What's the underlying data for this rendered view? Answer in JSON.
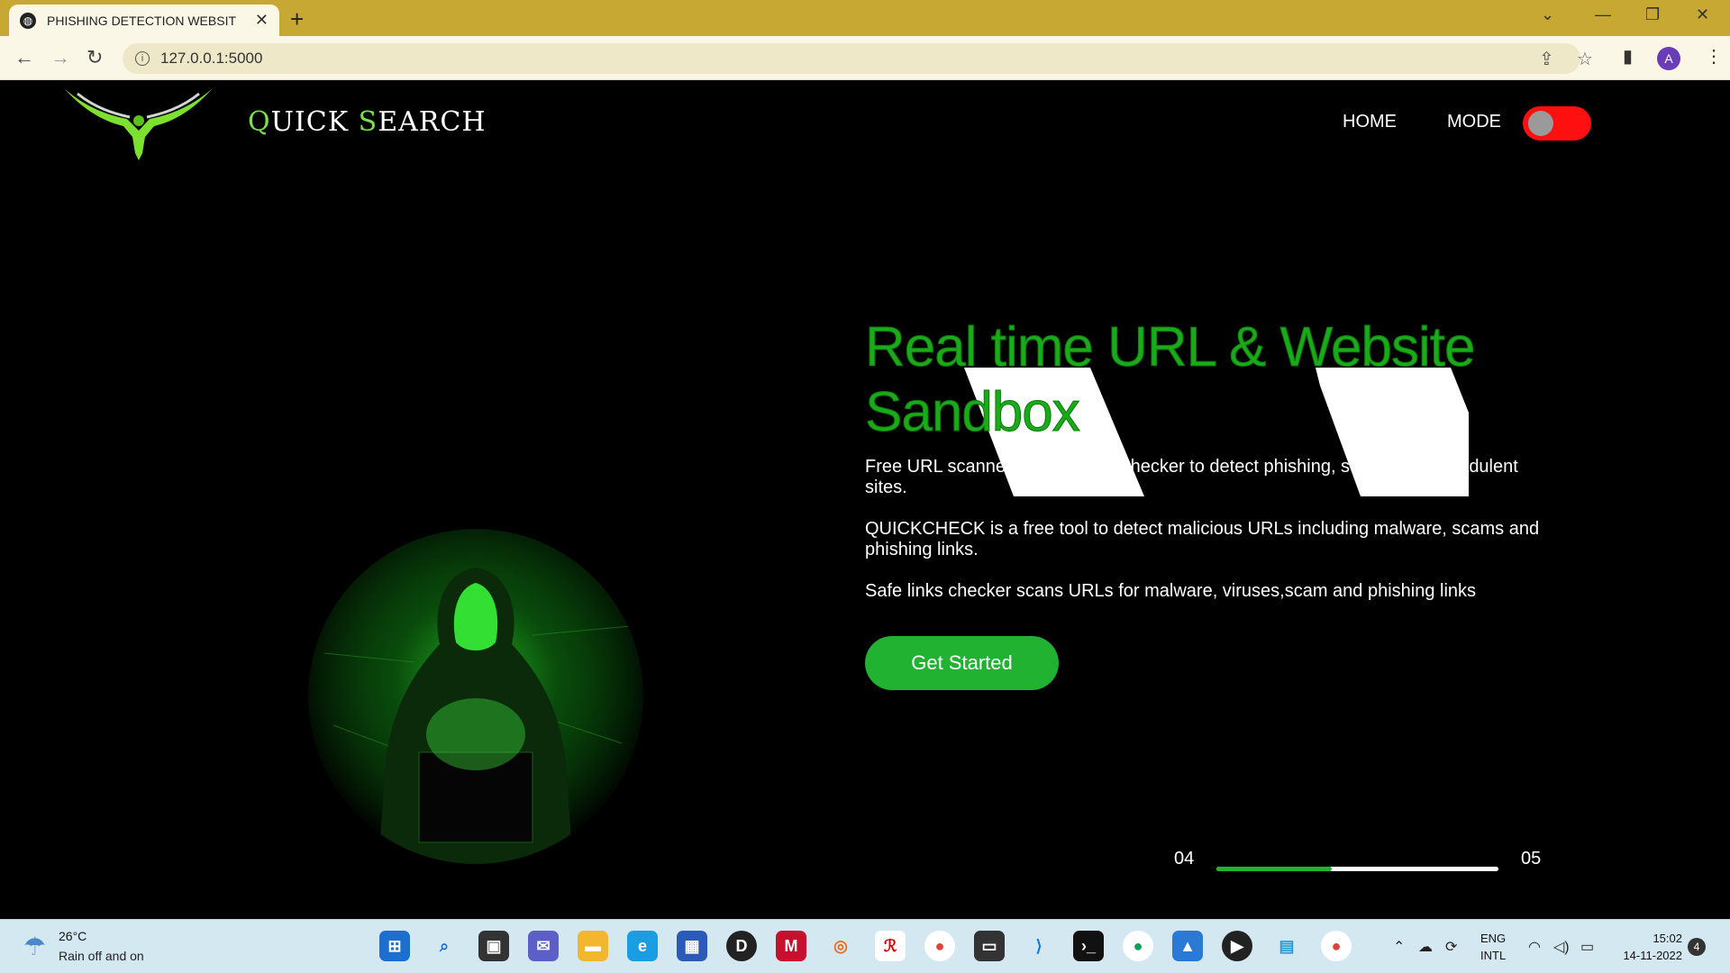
{
  "browser": {
    "tab_title": "PHISHING DETECTION WEBSITE-",
    "url": "127.0.0.1:5000",
    "profile_initial": "A"
  },
  "nav": {
    "brand_first_letter": "Q",
    "brand_rest1": "UICK ",
    "brand_second_letter": "S",
    "brand_rest2": "EARCH",
    "home_label": "HOME",
    "mode_label": "MODE"
  },
  "hero": {
    "headline": "Real time URL & Website Sandbox",
    "paragraphs": [
      "Free URL scanner and Website checker to detect phishing, scam sites & fradulent sites.",
      "QUICKCHECK is a free tool to detect malicious URLs including malware, scams and phishing links.",
      "Safe links checker scans URLs for malware, viruses,scam and phishing links"
    ],
    "cta_label": "Get Started"
  },
  "slider": {
    "current": "04",
    "total": "05",
    "progress_fraction": 0.41
  },
  "colors": {
    "accent_green": "#22b232",
    "toggle_red": "#ff1010",
    "tabbar": "#c6a833"
  },
  "taskbar": {
    "weather_temp": "26°C",
    "weather_desc": "Rain off and on",
    "lang_line1": "ENG",
    "lang_line2": "INTL",
    "time": "15:02",
    "date": "14-11-2022",
    "notification_count": "4"
  }
}
